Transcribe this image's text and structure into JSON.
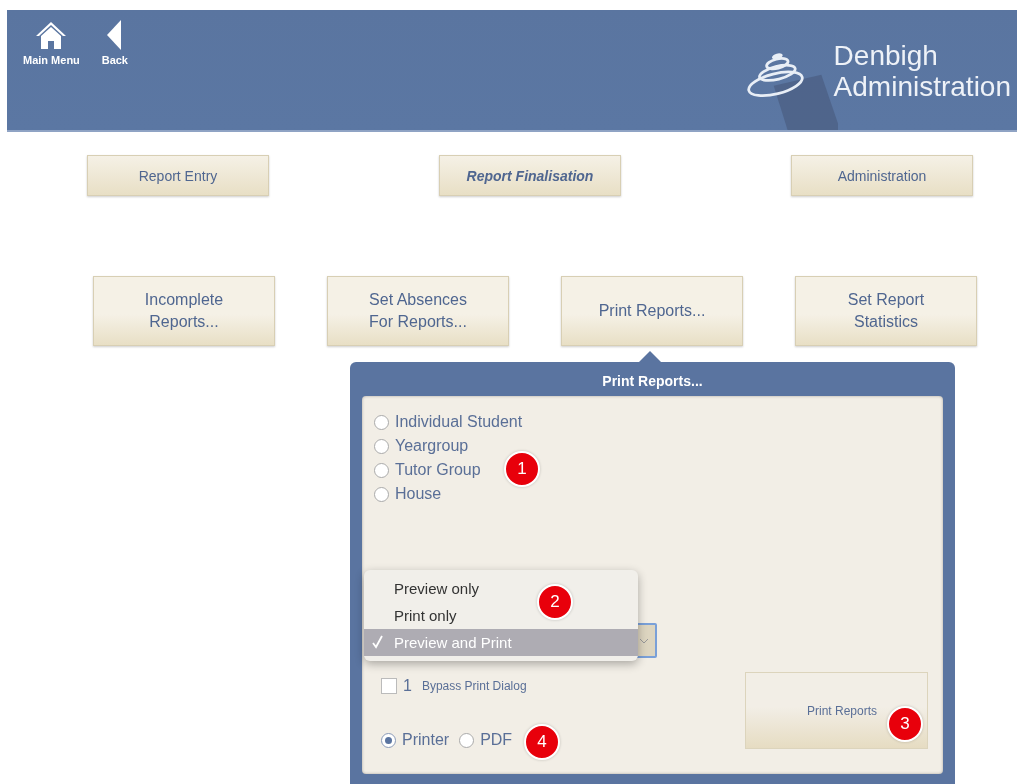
{
  "header": {
    "nav_buttons": [
      {
        "label": "Main Menu",
        "kind": "home"
      },
      {
        "label": "Back",
        "kind": "back"
      }
    ],
    "logo": {
      "line1": "Denbigh",
      "line2": "Administration"
    }
  },
  "tabs": [
    {
      "label": "Report Entry",
      "selected": false
    },
    {
      "label": "Report Finalisation",
      "selected": true
    },
    {
      "label": "Administration",
      "selected": false
    }
  ],
  "actions": [
    "Incomplete Reports...",
    "Set Absences For Reports...",
    "Print Reports...",
    "Set Report Statistics"
  ],
  "popup": {
    "title": "Print Reports...",
    "scope_options": [
      {
        "label": "Individual Student",
        "selected": false
      },
      {
        "label": "Yeargroup",
        "selected": false
      },
      {
        "label": "Tutor Group",
        "selected": false
      },
      {
        "label": "House",
        "selected": false
      }
    ],
    "output_menu": [
      {
        "label": "Preview only",
        "selected": false
      },
      {
        "label": "Print only",
        "selected": false
      },
      {
        "label": "Preview and Print",
        "selected": true
      }
    ],
    "bypass": {
      "checked": false,
      "count": "1",
      "label": "Bypass Print Dialog"
    },
    "destinations": [
      {
        "label": "Printer",
        "selected": true
      },
      {
        "label": "PDF",
        "selected": false
      }
    ],
    "print_button": "Print Reports"
  },
  "callouts": [
    "1",
    "2",
    "3",
    "4"
  ]
}
